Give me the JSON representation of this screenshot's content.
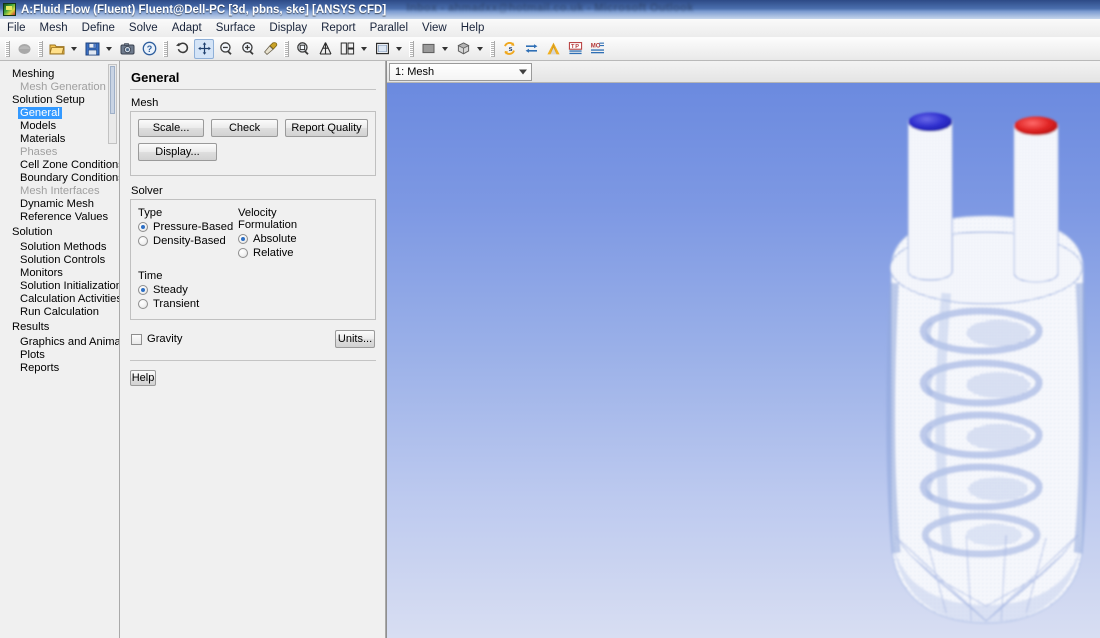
{
  "window": {
    "title": "A:Fluid Flow (Fluent) Fluent@Dell-PC  [3d, pbns, ske] [ANSYS CFD]",
    "background_window_title": "Inbox - ahmadxx@hotmail.co.uk - Microsoft Outlook",
    "app_icon": "fluent-app-icon"
  },
  "menubar": {
    "items": [
      {
        "label": "File"
      },
      {
        "label": "Mesh"
      },
      {
        "label": "Define"
      },
      {
        "label": "Solve"
      },
      {
        "label": "Adapt"
      },
      {
        "label": "Surface"
      },
      {
        "label": "Display"
      },
      {
        "label": "Report"
      },
      {
        "label": "Parallel"
      },
      {
        "label": "View"
      },
      {
        "label": "Help"
      }
    ]
  },
  "toolbar": {
    "groups": [
      {
        "buttons": [
          {
            "icon": "stop-icon",
            "label": "",
            "has_dropdown": false,
            "pressed": false,
            "disabled": true
          }
        ]
      },
      {
        "buttons": [
          {
            "icon": "open-folder-icon",
            "label": "",
            "has_dropdown": true,
            "pressed": false
          },
          {
            "icon": "save-icon",
            "label": "",
            "has_dropdown": true,
            "pressed": false
          },
          {
            "icon": "camera-icon",
            "label": "",
            "has_dropdown": false,
            "pressed": false
          },
          {
            "icon": "help-circle-icon",
            "label": "",
            "has_dropdown": false,
            "pressed": false
          }
        ]
      },
      {
        "buttons": [
          {
            "icon": "reset-rotate-icon",
            "label": "",
            "has_dropdown": false,
            "pressed": false
          },
          {
            "icon": "pan-move-icon",
            "label": "",
            "has_dropdown": false,
            "pressed": true
          },
          {
            "icon": "zoom-out-icon",
            "label": "",
            "has_dropdown": false,
            "pressed": false
          },
          {
            "icon": "zoom-in-icon",
            "label": "",
            "has_dropdown": false,
            "pressed": false
          },
          {
            "icon": "eyedropper-probe-icon",
            "label": "",
            "has_dropdown": false,
            "pressed": false
          }
        ]
      },
      {
        "buttons": [
          {
            "icon": "zoom-fit-icon",
            "label": "",
            "has_dropdown": false,
            "pressed": false
          },
          {
            "icon": "mesh-display-icon",
            "label": "",
            "has_dropdown": false,
            "pressed": false
          },
          {
            "icon": "layout-windows-icon",
            "label": "",
            "has_dropdown": true,
            "pressed": false
          },
          {
            "icon": "window-frame-icon",
            "label": "",
            "has_dropdown": true,
            "pressed": false
          }
        ]
      },
      {
        "buttons": [
          {
            "icon": "background-color-icon",
            "label": "",
            "has_dropdown": true,
            "pressed": false
          },
          {
            "icon": "render-shading-icon",
            "label": "",
            "has_dropdown": true,
            "pressed": false
          }
        ]
      },
      {
        "buttons": [
          {
            "icon": "refresh-case-icon",
            "label": "",
            "has_dropdown": false,
            "pressed": false
          },
          {
            "icon": "sync-arrows-icon",
            "label": "",
            "has_dropdown": false,
            "pressed": false
          },
          {
            "icon": "ansys-logo-icon",
            "label": "",
            "has_dropdown": false,
            "pressed": false
          },
          {
            "icon": "text-to-gui-icon",
            "label": "",
            "has_dropdown": false,
            "pressed": false
          },
          {
            "icon": "mo-list-icon",
            "label": "",
            "has_dropdown": false,
            "pressed": false
          }
        ]
      }
    ]
  },
  "sidebar": {
    "items": [
      {
        "label": "Meshing",
        "level": 0,
        "disabled": false,
        "selected": false
      },
      {
        "label": "Mesh Generation",
        "level": 1,
        "disabled": true,
        "selected": false
      },
      {
        "label": "Solution Setup",
        "level": 0,
        "disabled": false,
        "selected": false
      },
      {
        "label": "General",
        "level": 1,
        "disabled": false,
        "selected": true
      },
      {
        "label": "Models",
        "level": 1,
        "disabled": false,
        "selected": false
      },
      {
        "label": "Materials",
        "level": 1,
        "disabled": false,
        "selected": false
      },
      {
        "label": "Phases",
        "level": 1,
        "disabled": true,
        "selected": false
      },
      {
        "label": "Cell Zone Conditions",
        "level": 1,
        "disabled": false,
        "selected": false
      },
      {
        "label": "Boundary Conditions",
        "level": 1,
        "disabled": false,
        "selected": false
      },
      {
        "label": "Mesh Interfaces",
        "level": 1,
        "disabled": true,
        "selected": false
      },
      {
        "label": "Dynamic Mesh",
        "level": 1,
        "disabled": false,
        "selected": false
      },
      {
        "label": "Reference Values",
        "level": 1,
        "disabled": false,
        "selected": false
      },
      {
        "label": "Solution",
        "level": 0,
        "disabled": false,
        "selected": false
      },
      {
        "label": "Solution Methods",
        "level": 1,
        "disabled": false,
        "selected": false
      },
      {
        "label": "Solution Controls",
        "level": 1,
        "disabled": false,
        "selected": false
      },
      {
        "label": "Monitors",
        "level": 1,
        "disabled": false,
        "selected": false
      },
      {
        "label": "Solution Initialization",
        "level": 1,
        "disabled": false,
        "selected": false
      },
      {
        "label": "Calculation Activities",
        "level": 1,
        "disabled": false,
        "selected": false
      },
      {
        "label": "Run Calculation",
        "level": 1,
        "disabled": false,
        "selected": false
      },
      {
        "label": "Results",
        "level": 0,
        "disabled": false,
        "selected": false
      },
      {
        "label": "Graphics and Animations",
        "level": 1,
        "disabled": false,
        "selected": false
      },
      {
        "label": "Plots",
        "level": 1,
        "disabled": false,
        "selected": false
      },
      {
        "label": "Reports",
        "level": 1,
        "disabled": false,
        "selected": false
      }
    ]
  },
  "panel": {
    "title": "General",
    "mesh": {
      "group_label": "Mesh",
      "scale_label": "Scale...",
      "check_label": "Check",
      "report_quality_label": "Report Quality",
      "display_label": "Display..."
    },
    "solver": {
      "group_label": "Solver",
      "type_label": "Type",
      "type_options": [
        {
          "label": "Pressure-Based",
          "selected": true
        },
        {
          "label": "Density-Based",
          "selected": false
        }
      ],
      "velocity_label": "Velocity Formulation",
      "velocity_options": [
        {
          "label": "Absolute",
          "selected": true
        },
        {
          "label": "Relative",
          "selected": false
        }
      ],
      "time_label": "Time",
      "time_options": [
        {
          "label": "Steady",
          "selected": true
        },
        {
          "label": "Transient",
          "selected": false
        }
      ]
    },
    "gravity": {
      "label": "Gravity",
      "checked": false
    },
    "units_label": "Units...",
    "help_label": "Help"
  },
  "graphics": {
    "window_selector": {
      "value": "1: Mesh"
    },
    "scene": {
      "description": "3D wireframe mesh of a cylindrical vessel with internal helical coil and two vertical nozzle pipes",
      "inlet_cap_color": "#2b2bd8",
      "outlet_cap_color": "#e02020",
      "mesh_color": "#8fa6dc",
      "background_top_color": "#6b8adf",
      "background_bottom_color": "#d8def2"
    }
  }
}
